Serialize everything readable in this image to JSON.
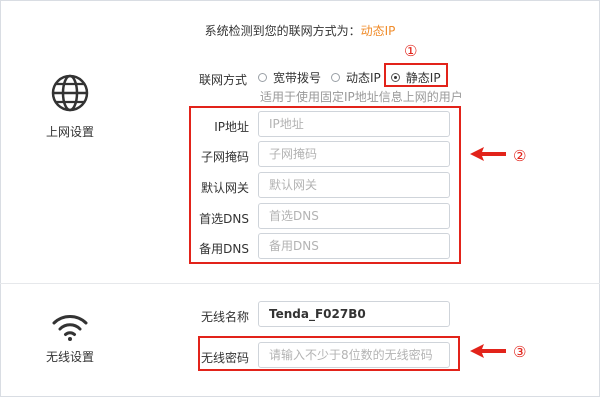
{
  "notice": {
    "prefix": "系统检测到您的联网方式为：",
    "mode": "动态IP"
  },
  "internet": {
    "title": "上网设置",
    "connection_label": "联网方式",
    "options": [
      {
        "label": "宽带拨号",
        "selected": false
      },
      {
        "label": "动态IP",
        "selected": false
      },
      {
        "label": "静态IP",
        "selected": true
      }
    ],
    "hint": "适用于使用固定IP地址信息上网的用户",
    "fields": [
      {
        "label": "IP地址",
        "placeholder": "IP地址",
        "value": ""
      },
      {
        "label": "子网掩码",
        "placeholder": "子网掩码",
        "value": ""
      },
      {
        "label": "默认网关",
        "placeholder": "默认网关",
        "value": ""
      },
      {
        "label": "首选DNS",
        "placeholder": "首选DNS",
        "value": ""
      },
      {
        "label": "备用DNS",
        "placeholder": "备用DNS",
        "value": ""
      }
    ]
  },
  "wireless": {
    "title": "无线设置",
    "ssid_label": "无线名称",
    "ssid_value": "Tenda_F027B0",
    "password_label": "无线密码",
    "password_placeholder": "请输入不少于8位数的无线密码"
  },
  "annotations": {
    "marker1": "①",
    "marker2": "②",
    "marker3": "③",
    "color": "#e2231a"
  },
  "colors": {
    "accent": "#f08c2b",
    "annotation": "#e2231a"
  },
  "icons": {
    "internet": "globe-icon",
    "wireless": "wifi-icon"
  }
}
